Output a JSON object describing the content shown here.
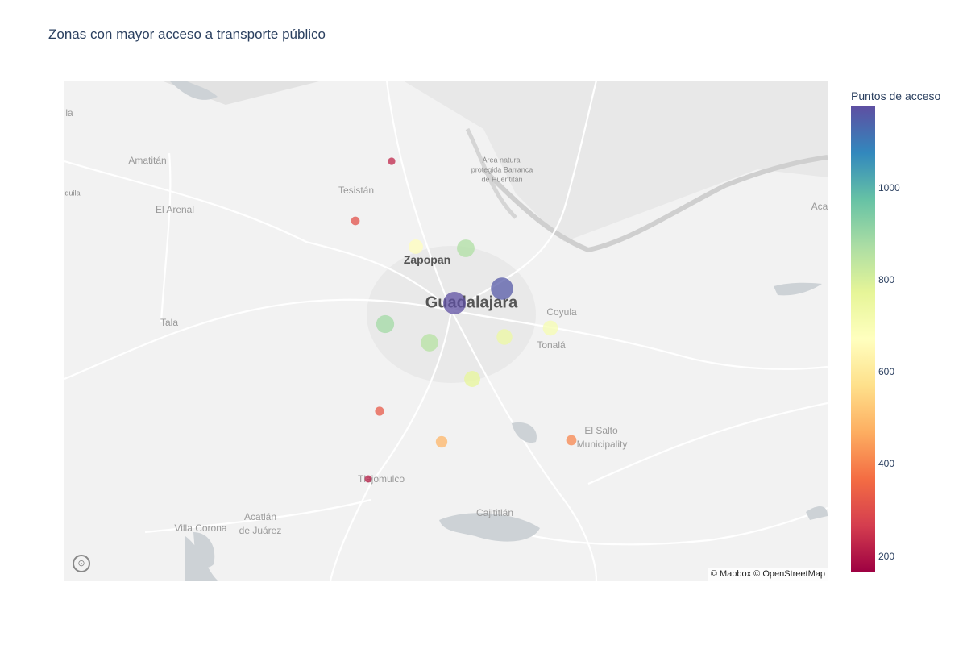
{
  "title": "Zonas con mayor acceso a transporte público",
  "colorbar": {
    "title": "Puntos de acceso",
    "ticks": [
      "200",
      "400",
      "600",
      "800",
      "1000"
    ],
    "range": [
      160,
      1170
    ],
    "colors": [
      "#9e0142",
      "#d53e4f",
      "#f46d43",
      "#fdae61",
      "#fee08b",
      "#ffffbf",
      "#e6f598",
      "#abdda4",
      "#66c2a5",
      "#3288bd",
      "#5e4fa2"
    ]
  },
  "map": {
    "places": [
      {
        "name": "Amatitán",
        "cls": ""
      },
      {
        "name": "Tesistán",
        "cls": ""
      },
      {
        "name": "El Arenal",
        "cls": ""
      },
      {
        "name": "Zapopan",
        "cls": "mid"
      },
      {
        "name": "Guadalajara",
        "cls": "big"
      },
      {
        "name": "Coyula",
        "cls": ""
      },
      {
        "name": "Tonalá",
        "cls": ""
      },
      {
        "name": "Tala",
        "cls": ""
      },
      {
        "name": "El Salto",
        "cls": ""
      },
      {
        "name": "Municipality",
        "cls": ""
      },
      {
        "name": "Tlajomulco",
        "cls": ""
      },
      {
        "name": "Acatlán",
        "cls": ""
      },
      {
        "name": "de Juárez",
        "cls": ""
      },
      {
        "name": "Villa Corona",
        "cls": ""
      },
      {
        "name": "Cajititlán",
        "cls": ""
      },
      {
        "name": "Área natural",
        "cls": "small"
      },
      {
        "name": "protegida Barranca",
        "cls": "small"
      },
      {
        "name": "de Huentitán",
        "cls": "small"
      },
      {
        "name": "la",
        "cls": ""
      },
      {
        "name": "quila",
        "cls": "small"
      },
      {
        "name": "Aca",
        "cls": ""
      }
    ],
    "attribution": "© Mapbox © OpenStreetMap",
    "logo_icon": "mapbox-logo-icon"
  },
  "chart_data": {
    "type": "scatter",
    "title": "Zonas con mayor acceso a transporte público",
    "colorbar_title": "Puntos de acceso",
    "color_range": [
      160,
      1170
    ],
    "points": [
      {
        "value": 220
      },
      {
        "value": 300
      },
      {
        "value": 660
      },
      {
        "value": 860
      },
      {
        "value": 1170
      },
      {
        "value": 1150
      },
      {
        "value": 880
      },
      {
        "value": 850
      },
      {
        "value": 740
      },
      {
        "value": 700
      },
      {
        "value": 760
      },
      {
        "value": 320
      },
      {
        "value": 480
      },
      {
        "value": 400
      },
      {
        "value": 210
      }
    ]
  }
}
